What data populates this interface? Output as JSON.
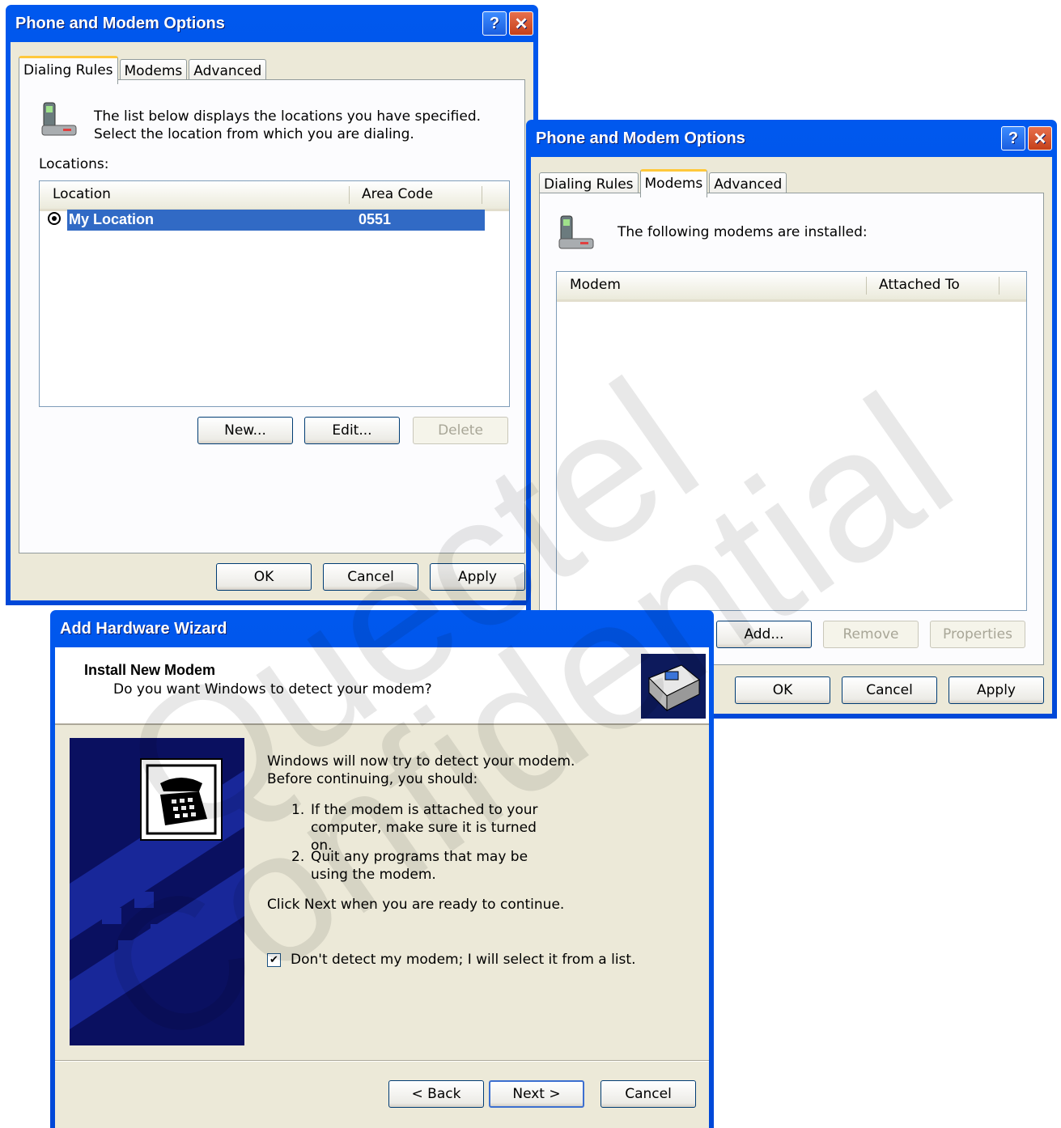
{
  "dialog1": {
    "title": "Phone and Modem Options",
    "tabs": [
      "Dialing Rules",
      "Modems",
      "Advanced"
    ],
    "active_tab": "Dialing Rules",
    "description": "The list below displays the locations you have specified. Select the location from which you are dialing.",
    "locations_label": "Locations:",
    "columns": [
      "Location",
      "Area Code"
    ],
    "rows": [
      {
        "location": "My Location",
        "area_code": "0551"
      }
    ],
    "buttons": {
      "new": "New...",
      "edit": "Edit...",
      "delete": "Delete"
    },
    "footer": {
      "ok": "OK",
      "cancel": "Cancel",
      "apply": "Apply"
    }
  },
  "dialog2": {
    "title": "Phone and Modem Options",
    "tabs": [
      "Dialing Rules",
      "Modems",
      "Advanced"
    ],
    "active_tab": "Modems",
    "description": "The following modems are  installed:",
    "columns": [
      "Modem",
      "Attached To"
    ],
    "buttons": {
      "add": "Add...",
      "remove": "Remove",
      "properties": "Properties"
    },
    "footer": {
      "ok": "OK",
      "cancel": "Cancel",
      "apply": "Apply"
    }
  },
  "wizard": {
    "title": "Add Hardware Wizard",
    "heading": "Install New Modem",
    "subheading": "Do you want Windows to detect your modem?",
    "intro": "Windows will now try to detect your modem.  Before continuing, you should:",
    "step1_num": "1.",
    "step1": "If the modem is attached to your computer, make sure it is turned on.",
    "step2_num": "2.",
    "step2": "Quit any programs that may be using the modem.",
    "outro": "Click Next when you are ready to continue.",
    "checkbox_label": "Don't detect my modem; I will select it from a list.",
    "checkbox_checked": true,
    "buttons": {
      "back": "< Back",
      "next": "Next >",
      "cancel": "Cancel"
    }
  },
  "watermark": [
    "Quectel",
    "Confidential"
  ],
  "colors": {
    "titlebar": "#0054e3",
    "selection": "#316ac5",
    "face": "#ece9d8",
    "tab_highlight": "#ffc83c"
  }
}
